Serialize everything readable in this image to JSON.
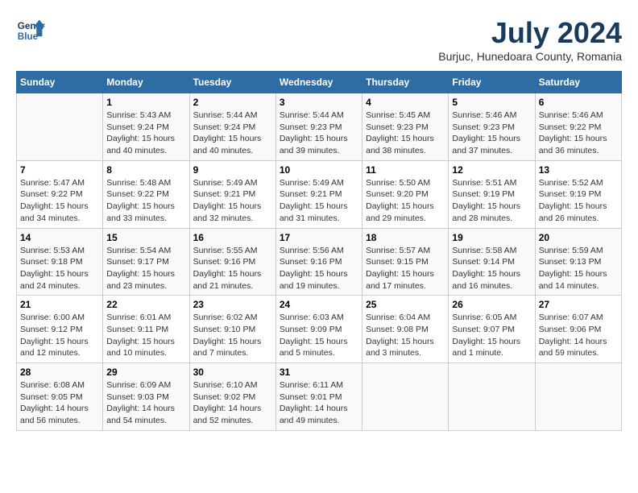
{
  "header": {
    "logo_line1": "General",
    "logo_line2": "Blue",
    "month_year": "July 2024",
    "location": "Burjuc, Hunedoara County, Romania"
  },
  "weekdays": [
    "Sunday",
    "Monday",
    "Tuesday",
    "Wednesday",
    "Thursday",
    "Friday",
    "Saturday"
  ],
  "weeks": [
    [
      {
        "day": "",
        "sunrise": "",
        "sunset": "",
        "daylight": ""
      },
      {
        "day": "1",
        "sunrise": "Sunrise: 5:43 AM",
        "sunset": "Sunset: 9:24 PM",
        "daylight": "Daylight: 15 hours and 40 minutes."
      },
      {
        "day": "2",
        "sunrise": "Sunrise: 5:44 AM",
        "sunset": "Sunset: 9:24 PM",
        "daylight": "Daylight: 15 hours and 40 minutes."
      },
      {
        "day": "3",
        "sunrise": "Sunrise: 5:44 AM",
        "sunset": "Sunset: 9:23 PM",
        "daylight": "Daylight: 15 hours and 39 minutes."
      },
      {
        "day": "4",
        "sunrise": "Sunrise: 5:45 AM",
        "sunset": "Sunset: 9:23 PM",
        "daylight": "Daylight: 15 hours and 38 minutes."
      },
      {
        "day": "5",
        "sunrise": "Sunrise: 5:46 AM",
        "sunset": "Sunset: 9:23 PM",
        "daylight": "Daylight: 15 hours and 37 minutes."
      },
      {
        "day": "6",
        "sunrise": "Sunrise: 5:46 AM",
        "sunset": "Sunset: 9:22 PM",
        "daylight": "Daylight: 15 hours and 36 minutes."
      }
    ],
    [
      {
        "day": "7",
        "sunrise": "Sunrise: 5:47 AM",
        "sunset": "Sunset: 9:22 PM",
        "daylight": "Daylight: 15 hours and 34 minutes."
      },
      {
        "day": "8",
        "sunrise": "Sunrise: 5:48 AM",
        "sunset": "Sunset: 9:22 PM",
        "daylight": "Daylight: 15 hours and 33 minutes."
      },
      {
        "day": "9",
        "sunrise": "Sunrise: 5:49 AM",
        "sunset": "Sunset: 9:21 PM",
        "daylight": "Daylight: 15 hours and 32 minutes."
      },
      {
        "day": "10",
        "sunrise": "Sunrise: 5:49 AM",
        "sunset": "Sunset: 9:21 PM",
        "daylight": "Daylight: 15 hours and 31 minutes."
      },
      {
        "day": "11",
        "sunrise": "Sunrise: 5:50 AM",
        "sunset": "Sunset: 9:20 PM",
        "daylight": "Daylight: 15 hours and 29 minutes."
      },
      {
        "day": "12",
        "sunrise": "Sunrise: 5:51 AM",
        "sunset": "Sunset: 9:19 PM",
        "daylight": "Daylight: 15 hours and 28 minutes."
      },
      {
        "day": "13",
        "sunrise": "Sunrise: 5:52 AM",
        "sunset": "Sunset: 9:19 PM",
        "daylight": "Daylight: 15 hours and 26 minutes."
      }
    ],
    [
      {
        "day": "14",
        "sunrise": "Sunrise: 5:53 AM",
        "sunset": "Sunset: 9:18 PM",
        "daylight": "Daylight: 15 hours and 24 minutes."
      },
      {
        "day": "15",
        "sunrise": "Sunrise: 5:54 AM",
        "sunset": "Sunset: 9:17 PM",
        "daylight": "Daylight: 15 hours and 23 minutes."
      },
      {
        "day": "16",
        "sunrise": "Sunrise: 5:55 AM",
        "sunset": "Sunset: 9:16 PM",
        "daylight": "Daylight: 15 hours and 21 minutes."
      },
      {
        "day": "17",
        "sunrise": "Sunrise: 5:56 AM",
        "sunset": "Sunset: 9:16 PM",
        "daylight": "Daylight: 15 hours and 19 minutes."
      },
      {
        "day": "18",
        "sunrise": "Sunrise: 5:57 AM",
        "sunset": "Sunset: 9:15 PM",
        "daylight": "Daylight: 15 hours and 17 minutes."
      },
      {
        "day": "19",
        "sunrise": "Sunrise: 5:58 AM",
        "sunset": "Sunset: 9:14 PM",
        "daylight": "Daylight: 15 hours and 16 minutes."
      },
      {
        "day": "20",
        "sunrise": "Sunrise: 5:59 AM",
        "sunset": "Sunset: 9:13 PM",
        "daylight": "Daylight: 15 hours and 14 minutes."
      }
    ],
    [
      {
        "day": "21",
        "sunrise": "Sunrise: 6:00 AM",
        "sunset": "Sunset: 9:12 PM",
        "daylight": "Daylight: 15 hours and 12 minutes."
      },
      {
        "day": "22",
        "sunrise": "Sunrise: 6:01 AM",
        "sunset": "Sunset: 9:11 PM",
        "daylight": "Daylight: 15 hours and 10 minutes."
      },
      {
        "day": "23",
        "sunrise": "Sunrise: 6:02 AM",
        "sunset": "Sunset: 9:10 PM",
        "daylight": "Daylight: 15 hours and 7 minutes."
      },
      {
        "day": "24",
        "sunrise": "Sunrise: 6:03 AM",
        "sunset": "Sunset: 9:09 PM",
        "daylight": "Daylight: 15 hours and 5 minutes."
      },
      {
        "day": "25",
        "sunrise": "Sunrise: 6:04 AM",
        "sunset": "Sunset: 9:08 PM",
        "daylight": "Daylight: 15 hours and 3 minutes."
      },
      {
        "day": "26",
        "sunrise": "Sunrise: 6:05 AM",
        "sunset": "Sunset: 9:07 PM",
        "daylight": "Daylight: 15 hours and 1 minute."
      },
      {
        "day": "27",
        "sunrise": "Sunrise: 6:07 AM",
        "sunset": "Sunset: 9:06 PM",
        "daylight": "Daylight: 14 hours and 59 minutes."
      }
    ],
    [
      {
        "day": "28",
        "sunrise": "Sunrise: 6:08 AM",
        "sunset": "Sunset: 9:05 PM",
        "daylight": "Daylight: 14 hours and 56 minutes."
      },
      {
        "day": "29",
        "sunrise": "Sunrise: 6:09 AM",
        "sunset": "Sunset: 9:03 PM",
        "daylight": "Daylight: 14 hours and 54 minutes."
      },
      {
        "day": "30",
        "sunrise": "Sunrise: 6:10 AM",
        "sunset": "Sunset: 9:02 PM",
        "daylight": "Daylight: 14 hours and 52 minutes."
      },
      {
        "day": "31",
        "sunrise": "Sunrise: 6:11 AM",
        "sunset": "Sunset: 9:01 PM",
        "daylight": "Daylight: 14 hours and 49 minutes."
      },
      {
        "day": "",
        "sunrise": "",
        "sunset": "",
        "daylight": ""
      },
      {
        "day": "",
        "sunrise": "",
        "sunset": "",
        "daylight": ""
      },
      {
        "day": "",
        "sunrise": "",
        "sunset": "",
        "daylight": ""
      }
    ]
  ]
}
